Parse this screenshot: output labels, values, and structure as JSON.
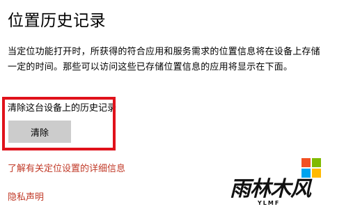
{
  "page": {
    "title": "位置历史记录",
    "description": "当定位功能打开时，所获得的符合应用和服务需求的位置信息将在设备上存储一定的时间。那些可以访问这些已存储位置信息的应用将显示在下面。"
  },
  "history": {
    "label": "清除这台设备上的历史记录",
    "clear_button": "清除"
  },
  "links": {
    "learn_more": "了解有关定位设置的详细信息",
    "privacy": "隐私声明"
  },
  "watermark": {
    "text": "雨林木风",
    "sub": "YLMF"
  },
  "colors": {
    "link": "#c13a28",
    "highlight": "#e0121b",
    "button_bg": "#cccccc"
  }
}
